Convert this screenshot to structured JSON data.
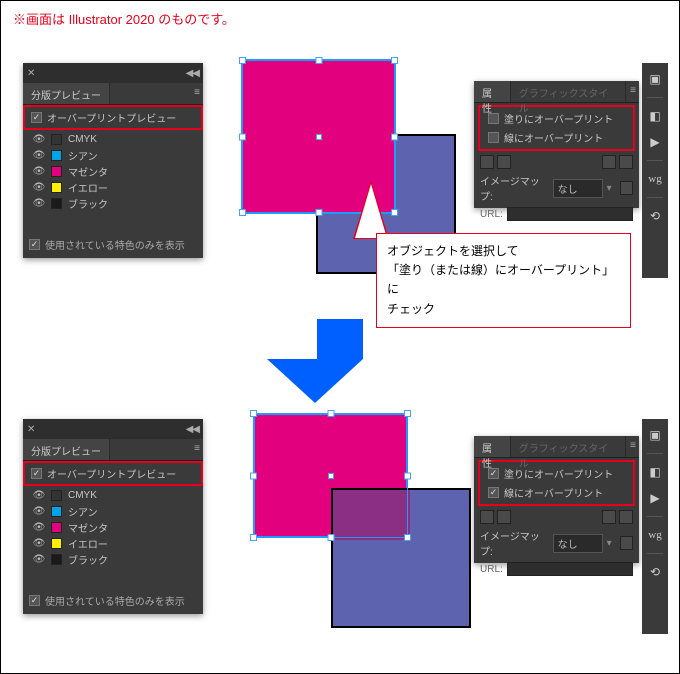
{
  "note": "※画面は Illustrator 2020 のものです。",
  "sep_panel": {
    "title": "分版プレビュー",
    "overprint_preview": "オーバープリントプレビュー",
    "only_used": "使用されている特色のみを表示",
    "items": [
      {
        "name": "CMYK",
        "color": "#333333"
      },
      {
        "name": "シアン",
        "color": "#00a3e8"
      },
      {
        "name": "マゼンタ",
        "color": "#e2007e"
      },
      {
        "name": "イエロー",
        "color": "#ffef00"
      },
      {
        "name": "ブラック",
        "color": "#1a1a1a"
      }
    ]
  },
  "attr_panel": {
    "tabs": {
      "attr": "属性",
      "graphic": "グラフィックスタイル"
    },
    "fill_overprint": "塗りにオーバープリント",
    "stroke_overprint": "線にオーバープリント",
    "imagemap_label": "イメージマップ:",
    "imagemap_value": "なし",
    "url_label": "URL:"
  },
  "callout": {
    "line1": "オブジェクトを選択して",
    "line2": "「塗り（または線）にオーバープリント」に",
    "line3": "チェック"
  },
  "colors": {
    "magenta": "#e2007e",
    "blue": "#5e63b0",
    "overlay": "#8a2f84"
  }
}
